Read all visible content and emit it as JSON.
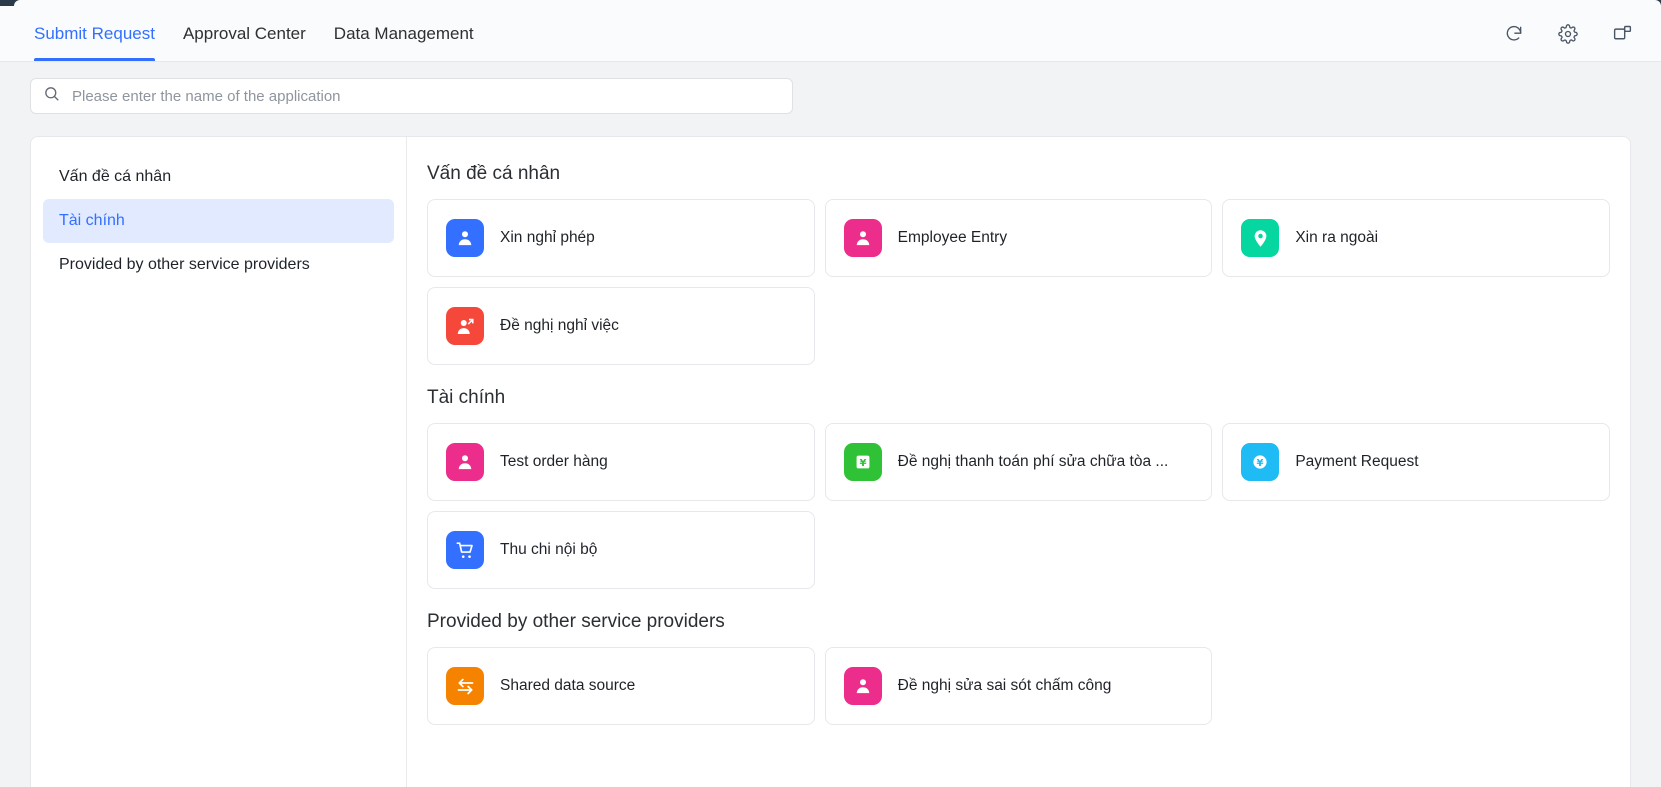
{
  "header": {
    "tabs": [
      {
        "label": "Submit Request",
        "active": true
      },
      {
        "label": "Approval Center",
        "active": false
      },
      {
        "label": "Data Management",
        "active": false
      }
    ],
    "actions": [
      {
        "name": "refresh-icon",
        "label": "Refresh"
      },
      {
        "name": "gear-icon",
        "label": "Settings"
      },
      {
        "name": "popout-window-icon",
        "label": "Open in new window"
      }
    ]
  },
  "search": {
    "placeholder": "Please enter the name of the application",
    "value": "",
    "icon": "search-icon",
    "clipped_text": "··"
  },
  "sidebar": {
    "items": [
      {
        "label": "Vấn đề cá nhân",
        "active": false
      },
      {
        "label": "Tài chính",
        "active": true
      },
      {
        "label": "Provided by other service providers",
        "active": false
      }
    ]
  },
  "sections": [
    {
      "title": "Vấn đề cá nhân",
      "cards": [
        {
          "label": "Xin nghỉ phép",
          "icon": "person-icon",
          "color": "#3370ff"
        },
        {
          "label": "Employee Entry",
          "icon": "person-icon",
          "color": "#ec2d8b"
        },
        {
          "label": "Xin ra ngoài",
          "icon": "location-pin-icon",
          "color": "#06d6a0"
        },
        {
          "label": "Đề nghị nghỉ việc",
          "icon": "person-exit-icon",
          "color": "#f5483b"
        }
      ]
    },
    {
      "title": "Tài chính",
      "cards": [
        {
          "label": "Test order hàng",
          "icon": "person-icon",
          "color": "#ec2d8b"
        },
        {
          "label": "Đề nghị thanh toán phí sửa chữa tòa ...",
          "icon": "yen-square-icon",
          "color": "#2fc236"
        },
        {
          "label": "Payment Request",
          "icon": "yen-circle-icon",
          "color": "#1fbbf5"
        },
        {
          "label": "Thu chi nội bộ",
          "icon": "shopping-cart-icon",
          "color": "#3370ff"
        }
      ]
    },
    {
      "title": "Provided by other service providers",
      "cards": [
        {
          "label": "Shared data source",
          "icon": "exchange-arrows-icon",
          "color": "#f58300"
        },
        {
          "label": "Đề nghị sửa sai sót chấm công",
          "icon": "person-icon",
          "color": "#ec2d8b"
        }
      ]
    }
  ],
  "colors": {
    "accent": "#3370ff",
    "page_bg": "#f2f3f5",
    "panel_bg": "#ffffff",
    "sidebar_active_bg": "#e1eaff"
  }
}
